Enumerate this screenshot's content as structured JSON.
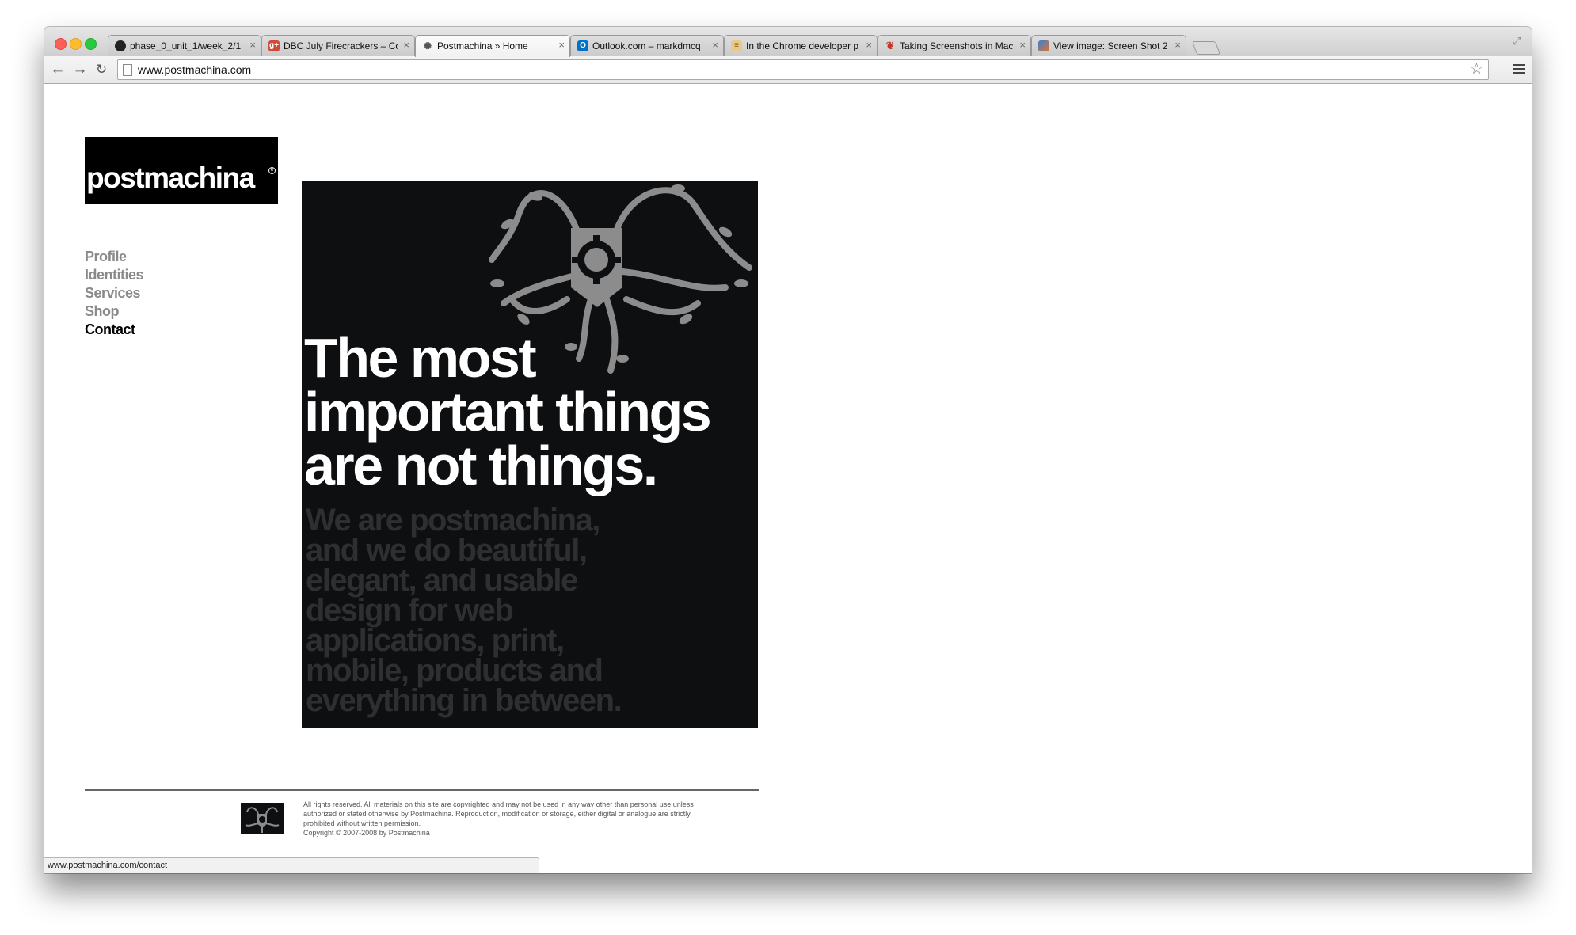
{
  "tabs": [
    {
      "title": "phase_0_unit_1/week_2/1",
      "favicon": "github-icon",
      "color": "#222222"
    },
    {
      "title": "DBC July Firecrackers – Co",
      "favicon": "google-plus-icon",
      "color": "#d34836"
    },
    {
      "title": "Postmachina » Home",
      "favicon": "postmachina-icon",
      "color": "#555555",
      "active": true
    },
    {
      "title": "Outlook.com – markdmcq",
      "favicon": "outlook-icon",
      "color": "#0072c6"
    },
    {
      "title": "In the Chrome developer p",
      "favicon": "document-icon",
      "color": "#c28a2a"
    },
    {
      "title": "Taking Screenshots in Mac",
      "favicon": "apple-icon",
      "color": "#c0392b"
    },
    {
      "title": "View image: Screen Shot 2",
      "favicon": "image-icon",
      "color": "#e0742a"
    }
  ],
  "toolbar": {
    "url": "www.postmachina.com"
  },
  "page": {
    "logo": "postmachina",
    "nav": [
      "Profile",
      "Identities",
      "Services",
      "Shop",
      "Contact"
    ],
    "nav_current": "Contact",
    "headline": [
      "The most",
      "important things",
      "are not things."
    ],
    "tagline": [
      "We are postmachina,",
      "and we do beautiful,",
      "elegant, and usable",
      "design for web",
      "applications, print,",
      "mobile, products and",
      "everything in between."
    ],
    "footer_lines": [
      "All rights reserved. All materials on this site are copyrighted and may not be used in any way other than personal use unless",
      "authorized or stated otherwise by Postmachina. Reproduction, modification or storage, either digital or analogue are strictly",
      "prohibited without written permission.",
      "Copyright © 2007-2008 by Postmachina"
    ]
  },
  "status": {
    "url": "www.postmachina.com/contact"
  },
  "colors": {
    "hero_bg": "#0e0f11",
    "nav_inactive": "#8a8a8a",
    "art_gray": "#8c8c8c"
  }
}
